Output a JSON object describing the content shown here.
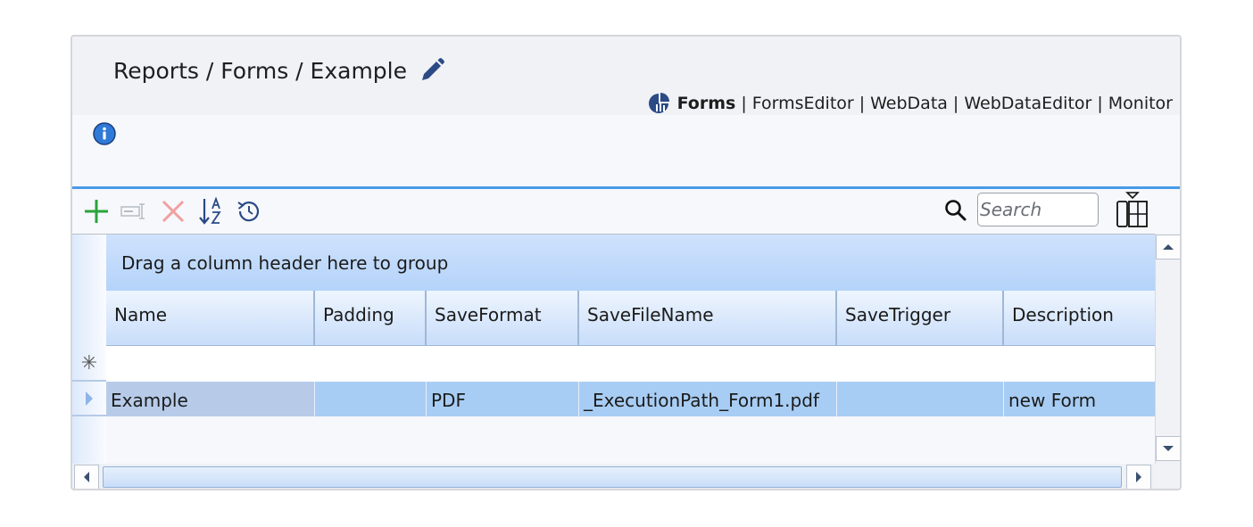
{
  "breadcrumb": "Reports / Forms / Example",
  "nav": {
    "active": "Forms",
    "separator": "|",
    "links": [
      "FormsEditor",
      "WebData",
      "WebDataEditor",
      "Monitor"
    ]
  },
  "toolbar": {
    "search_placeholder": "Search"
  },
  "grid": {
    "group_hint": "Drag a column header here to group",
    "columns": [
      "Name",
      "Padding",
      "SaveFormat",
      "SaveFileName",
      "SaveTrigger",
      "Description"
    ],
    "new_row_symbol": "✳",
    "rows": [
      [
        "Example",
        "",
        "PDF",
        "_ExecutionPath_Form1.pdf",
        "",
        "new Form"
      ]
    ]
  },
  "icons": {
    "edit": "pencil-icon",
    "forms": "pie-chart-icon",
    "info": "info-icon",
    "add": "plus-icon",
    "rename": "rename-icon",
    "delete": "close-icon",
    "sort": "sort-az-icon",
    "history": "history-icon",
    "search": "search-icon",
    "columns": "column-chooser-icon"
  },
  "colors": {
    "accent": "#4a9ae8",
    "selected_row": "#a8cdf4",
    "add_green": "#2aa33a",
    "delete_red": "#f0a0a0"
  }
}
